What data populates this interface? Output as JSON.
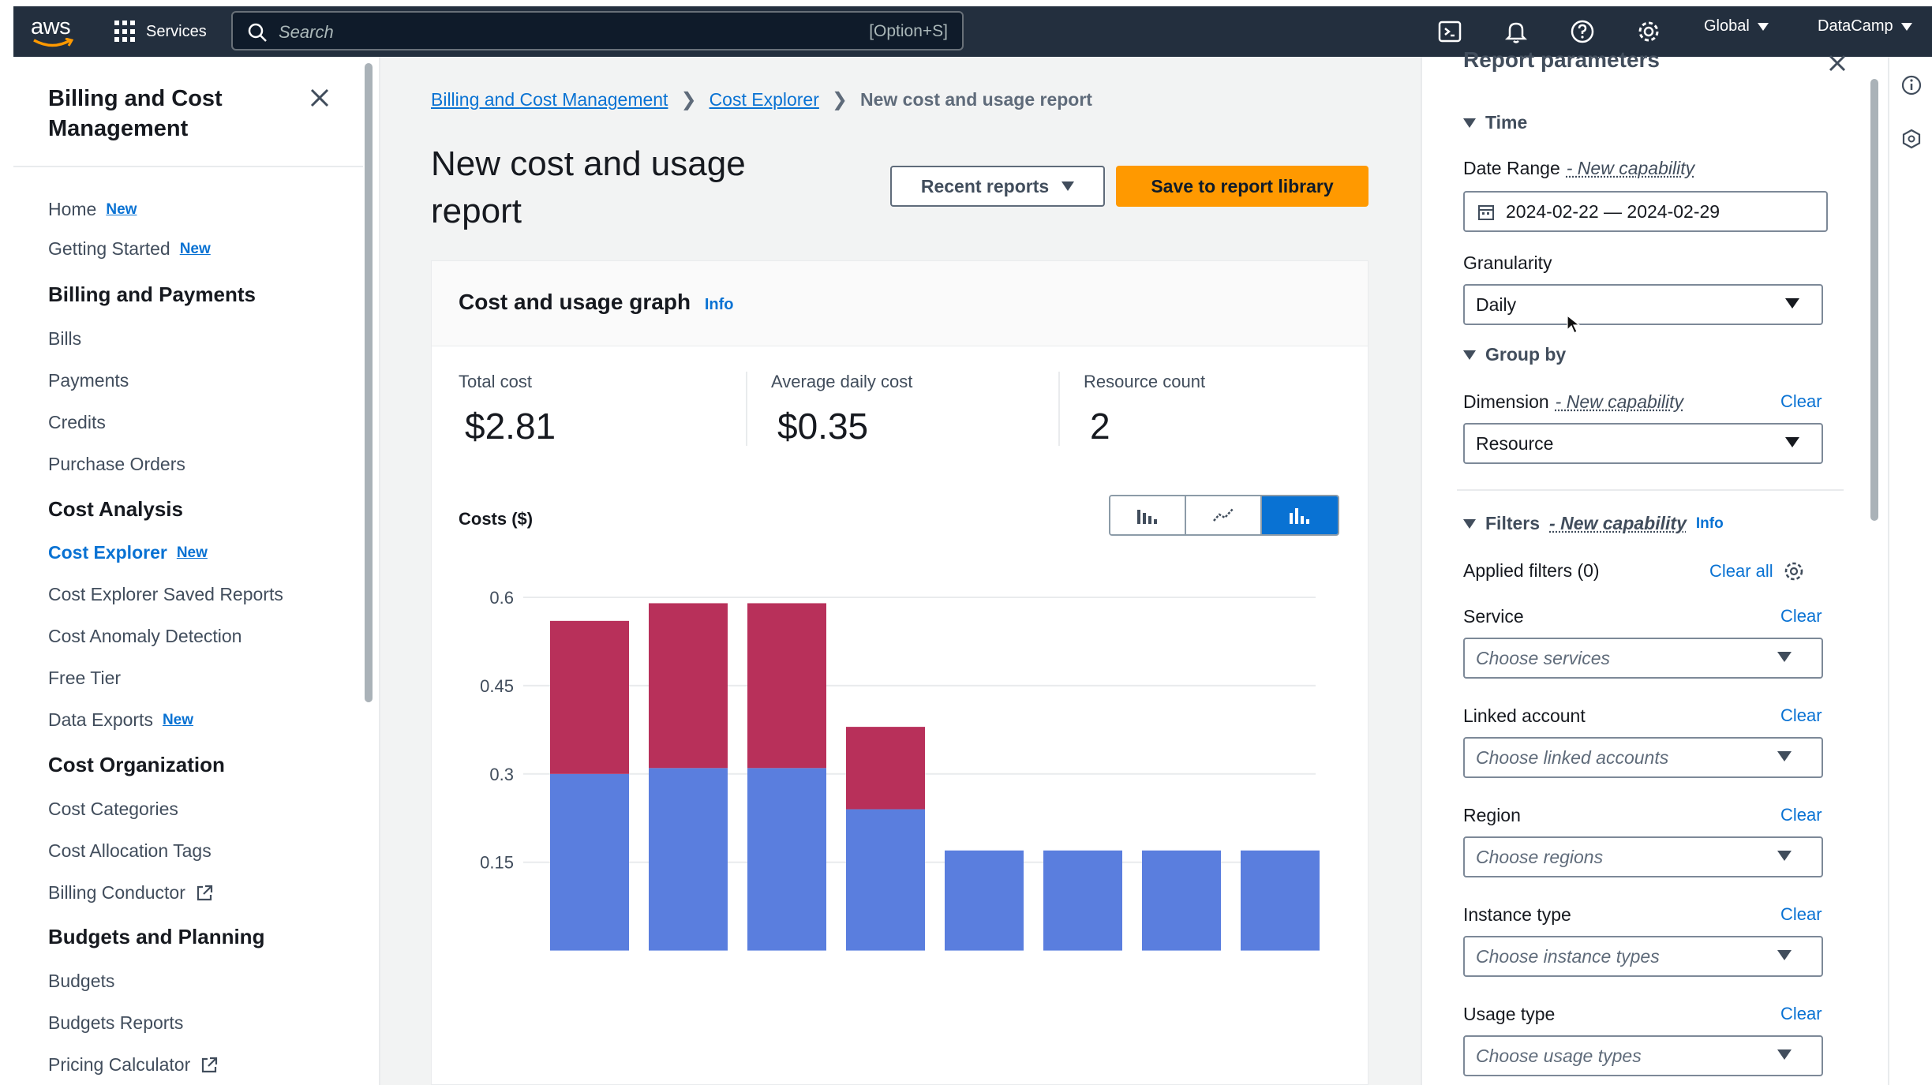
{
  "topnav": {
    "logo_text": "aws",
    "services_label": "Services",
    "search_placeholder": "Search",
    "search_shortcut": "[Option+S]",
    "region_label": "Global",
    "account_label": "DataCamp"
  },
  "sidebar": {
    "title": "Billing and Cost Management",
    "items": [
      {
        "label": "Home",
        "badge": "New"
      },
      {
        "label": "Getting Started",
        "badge": "New"
      }
    ],
    "sections": [
      {
        "heading": "Billing and Payments",
        "items": [
          "Bills",
          "Payments",
          "Credits",
          "Purchase Orders"
        ]
      },
      {
        "heading": "Cost Analysis",
        "items": [
          "Cost Explorer",
          "Cost Explorer Saved Reports",
          "Cost Anomaly Detection",
          "Free Tier",
          "Data Exports"
        ]
      },
      {
        "heading": "Cost Organization",
        "items": [
          "Cost Categories",
          "Cost Allocation Tags",
          "Billing Conductor"
        ]
      },
      {
        "heading": "Budgets and Planning",
        "items": [
          "Budgets",
          "Budgets Reports",
          "Pricing Calculator"
        ]
      }
    ],
    "badge_new": "New"
  },
  "breadcrumb": {
    "items": [
      "Billing and Cost Management",
      "Cost Explorer",
      "New cost and usage report"
    ]
  },
  "page": {
    "title": "New cost and usage report",
    "recent_reports_label": "Recent reports",
    "save_label": "Save to report library"
  },
  "graph": {
    "title": "Cost and usage graph",
    "info_label": "Info",
    "kpis": [
      {
        "label": "Total cost",
        "value": "$2.81"
      },
      {
        "label": "Average daily cost",
        "value": "$0.35"
      },
      {
        "label": "Resource count",
        "value": "2"
      }
    ],
    "axis_label": "Costs ($)"
  },
  "chart_data": {
    "type": "bar",
    "stacked": true,
    "ylabel": "Costs ($)",
    "ylim": [
      0,
      0.6
    ],
    "yticks": [
      0.15,
      0.3,
      0.45,
      0.6
    ],
    "series": [
      {
        "values": [
          0.3,
          0.31,
          0.31,
          0.24,
          0.17,
          0.17,
          0.17,
          0.17
        ],
        "color": "#5a7ede"
      },
      {
        "values": [
          0.26,
          0.28,
          0.28,
          0.14,
          0,
          0,
          0,
          0
        ],
        "color": "#b8305a"
      }
    ],
    "grid": true
  },
  "panel": {
    "title": "Report parameters",
    "time_section": "Time",
    "date_range_label": "Date Range",
    "new_capability": "- New capability",
    "date_range_value": "2024-02-22 — 2024-02-29",
    "granularity_label": "Granularity",
    "granularity_value": "Daily",
    "group_by_section": "Group by",
    "dimension_label": "Dimension",
    "dimension_value": "Resource",
    "clear_label": "Clear",
    "filters_section": "Filters",
    "info_label": "Info",
    "applied_filters": "Applied filters (0)",
    "clear_all": "Clear all",
    "filters": [
      {
        "label": "Service",
        "placeholder": "Choose services"
      },
      {
        "label": "Linked account",
        "placeholder": "Choose linked accounts"
      },
      {
        "label": "Region",
        "placeholder": "Choose regions"
      },
      {
        "label": "Instance type",
        "placeholder": "Choose instance types"
      },
      {
        "label": "Usage type",
        "placeholder": "Choose usage types"
      }
    ]
  }
}
